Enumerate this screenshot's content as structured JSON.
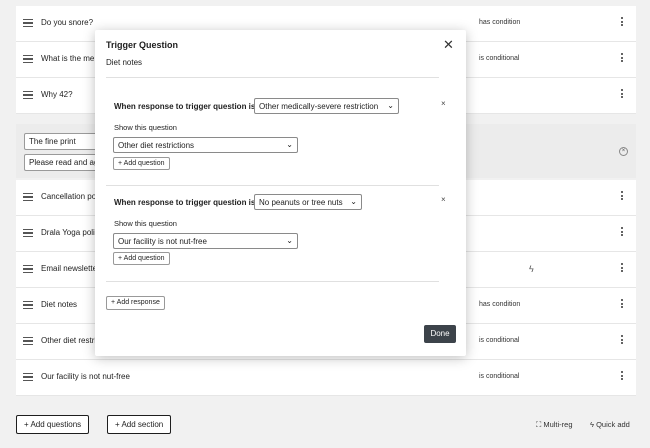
{
  "rows": [
    {
      "label": "Do you snore?",
      "status": "has condition"
    },
    {
      "label": "What is the me",
      "status": "is conditional"
    },
    {
      "label": "Why 42?",
      "status": ""
    },
    {
      "label": "Cancellation po",
      "status": ""
    },
    {
      "label": "Drala Yoga poli",
      "status": ""
    },
    {
      "label": "Email newslette",
      "status": ""
    },
    {
      "label": "Diet notes",
      "status": "has condition"
    },
    {
      "label": "Other diet restri",
      "status": "is conditional"
    },
    {
      "label": "Our facility is not nut-free",
      "status": "is conditional"
    }
  ],
  "section": {
    "title_value": "The fine print",
    "desc_value": "Please read and ag"
  },
  "icons": {
    "handle": "drag-handle-icon",
    "more": "more-vertical-icon",
    "bolt": "lightning-icon",
    "close": "close-icon",
    "chevron": "chevron-down-icon"
  },
  "footer": {
    "add_questions": "+ Add questions",
    "add_section": "+ Add section",
    "multi_reg": "Multi-reg",
    "quick_add": "Quick add"
  },
  "modal": {
    "title": "Trigger Question",
    "subtitle": "Diet notes",
    "responses": [
      {
        "when_label": "When response to trigger question is",
        "trigger_value": "Other medically-severe restriction",
        "show_label": "Show this question",
        "question_value": "Other diet restrictions",
        "add_question": "+ Add question"
      },
      {
        "when_label": "When response to trigger question is",
        "trigger_value": "No peanuts or tree nuts",
        "show_label": "Show this question",
        "question_value": "Our facility is not nut-free",
        "add_question": "+ Add question"
      }
    ],
    "add_response": "+ Add response",
    "done": "Done"
  }
}
